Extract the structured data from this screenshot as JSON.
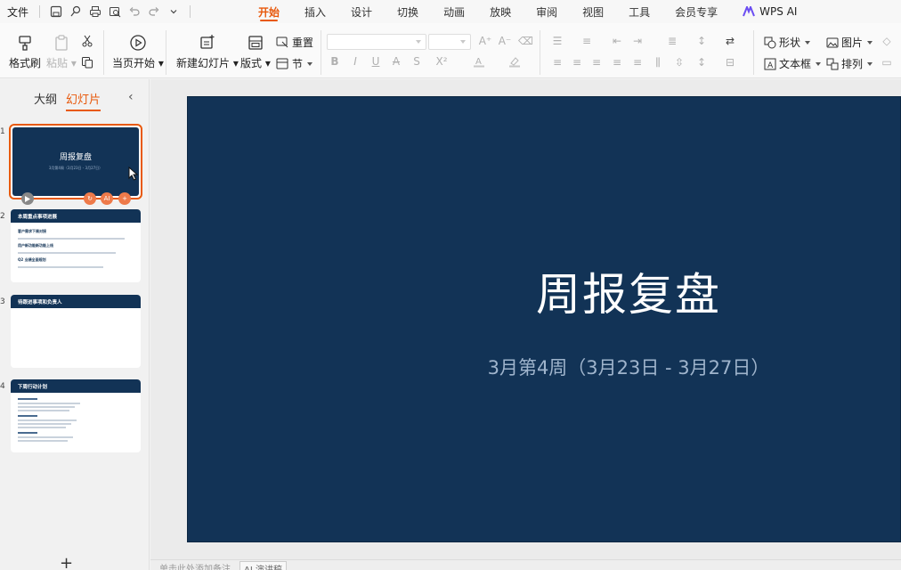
{
  "menubar": {
    "file_label": "文件",
    "quick_access": [
      "save-icon",
      "share-icon",
      "print-icon",
      "print-preview-icon",
      "undo-icon",
      "redo-icon",
      "chevron-down-icon"
    ],
    "tabs": [
      "开始",
      "插入",
      "设计",
      "切换",
      "动画",
      "放映",
      "审阅",
      "视图",
      "工具",
      "会员专享"
    ],
    "active_tab": "开始",
    "ai_label": "WPS AI"
  },
  "ribbon": {
    "format_painter": "格式刷",
    "paste": "粘贴",
    "play_from_current": "当页开始",
    "new_slide": "新建幻灯片",
    "layout": "版式",
    "reset": "重置",
    "section": "节",
    "shape": "形状",
    "picture": "图片",
    "textbox": "文本框",
    "arrange": "排列",
    "font_buttons": [
      "B",
      "I",
      "U",
      "A",
      "S",
      "X²"
    ]
  },
  "left_panel": {
    "tab_outline": "大纲",
    "tab_slides": "幻灯片",
    "thumbnails": [
      {
        "num": "1",
        "title": "周报复盘",
        "subtitle": "3月第4周（3月23日 - 3月27日）"
      },
      {
        "num": "2",
        "header": "本周重点事项进展",
        "items": [
          "客户需求下周对接",
          "用户新功能新功能上线",
          "Q2 业绩全面规划"
        ]
      },
      {
        "num": "3",
        "header": "待跟进事项和负责人"
      },
      {
        "num": "4",
        "header": "下周行动计划"
      }
    ],
    "add_label": "+"
  },
  "slide": {
    "title": "周报复盘",
    "subtitle": "3月第4周（3月23日 - 3月27日）"
  },
  "statusbar": {
    "notes": "单击此处添加备注",
    "ai_notes": "AI 演讲稿"
  },
  "colors": {
    "accent": "#e8590c",
    "slide_bg": "#123356",
    "subtitle": "#9fb4cc"
  }
}
